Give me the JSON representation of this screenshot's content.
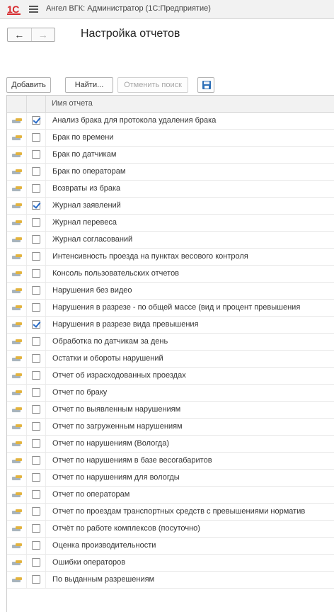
{
  "app": {
    "logo_text": "1С",
    "title": "Ангел ВГК: Администратор  (1С:Предприятие)"
  },
  "nav": {
    "back_icon": "←",
    "forward_icon": "→"
  },
  "page": {
    "title": "Настройка отчетов"
  },
  "toolbar": {
    "add_label": "Добавить",
    "find_label": "Найти...",
    "cancel_search_label": "Отменить поиск",
    "save_icon": "floppy-disk-icon"
  },
  "table": {
    "header_name": "Имя отчета",
    "rows": [
      {
        "name": "Анализ брака для протокола удаления брака",
        "checked": true
      },
      {
        "name": "Брак по времени",
        "checked": false
      },
      {
        "name": "Брак по датчикам",
        "checked": false
      },
      {
        "name": "Брак по операторам",
        "checked": false
      },
      {
        "name": "Возвраты из брака",
        "checked": false
      },
      {
        "name": "Журнал заявлений",
        "checked": true
      },
      {
        "name": "Журнал перевеса",
        "checked": false
      },
      {
        "name": "Журнал согласований",
        "checked": false
      },
      {
        "name": "Интенсивность проезда на пунктах весового контроля",
        "checked": false
      },
      {
        "name": "Консоль пользовательских отчетов",
        "checked": false
      },
      {
        "name": "Нарушения без видео",
        "checked": false
      },
      {
        "name": "Нарушения в разрезе - по общей массе (вид и процент превышения",
        "checked": false
      },
      {
        "name": "Нарушения в разрезе вида превышения",
        "checked": true
      },
      {
        "name": "Обработка по датчикам за день",
        "checked": false
      },
      {
        "name": "Остатки и обороты нарушений",
        "checked": false
      },
      {
        "name": "Отчет об израсходованных проездах",
        "checked": false
      },
      {
        "name": "Отчет по браку",
        "checked": false
      },
      {
        "name": "Отчет по выявленным нарушениям",
        "checked": false
      },
      {
        "name": "Отчет по загруженным нарушениям",
        "checked": false
      },
      {
        "name": "Отчет по нарушениям (Вологда)",
        "checked": false
      },
      {
        "name": "Отчет по нарушениям в базе весогабаритов",
        "checked": false
      },
      {
        "name": "Отчет по нарушениям для вологды",
        "checked": false
      },
      {
        "name": "Отчет по операторам",
        "checked": false
      },
      {
        "name": "Отчет по проездам транспортных средств с превышениями норматив",
        "checked": false
      },
      {
        "name": "Отчёт по работе комплексов (посуточно)",
        "checked": false
      },
      {
        "name": "Оценка производительности",
        "checked": false
      },
      {
        "name": "Ошибки операторов",
        "checked": false
      },
      {
        "name": "По выданным разрешениям",
        "checked": false
      }
    ]
  },
  "colors": {
    "logo_red": "#d6262a",
    "check_blue": "#2a6cc8",
    "header_bg": "#f2f2f2"
  }
}
